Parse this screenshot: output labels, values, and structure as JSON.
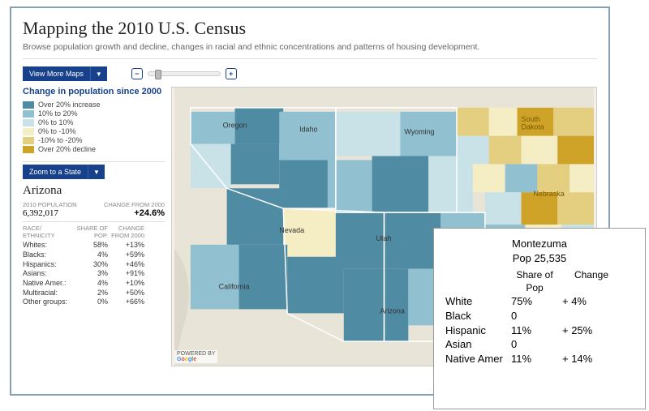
{
  "header": {
    "title": "Mapping the 2010 U.S. Census",
    "subtitle": "Browse population growth and decline, changes in racial and ethnic concentrations and patterns of housing development."
  },
  "buttons": {
    "view_more": "View More Maps",
    "zoom_state": "Zoom to a State"
  },
  "legend": {
    "title": "Change in population since 2000",
    "items": [
      {
        "label": "Over 20% increase",
        "color": "#4f8ca3"
      },
      {
        "label": "10% to 20%",
        "color": "#91c1d0"
      },
      {
        "label": "0% to 10%",
        "color": "#c9e2e7"
      },
      {
        "label": "0% to -10%",
        "color": "#f5edc3"
      },
      {
        "label": "-10% to -20%",
        "color": "#e3cf7f"
      },
      {
        "label": "Over 20% decline",
        "color": "#cfa328"
      }
    ]
  },
  "state_panel": {
    "name": "Arizona",
    "pop_label": "2010 POPULATION",
    "chg_label": "CHANGE FROM 2000",
    "population": "6,392,017",
    "change": "+24.6%",
    "col1": "RACE/ ETHNICITY",
    "col2": "SHARE OF POP.",
    "col3": "CHANGE FROM 2000",
    "rows": [
      {
        "label": "Whites:",
        "share": "58%",
        "change": "+13%"
      },
      {
        "label": "Blacks:",
        "share": "4%",
        "change": "+59%"
      },
      {
        "label": "Hispanics:",
        "share": "30%",
        "change": "+46%"
      },
      {
        "label": "Asians:",
        "share": "3%",
        "change": "+91%"
      },
      {
        "label": "Native Amer.:",
        "share": "4%",
        "change": "+10%"
      },
      {
        "label": "Multiracial:",
        "share": "2%",
        "change": "+50%"
      },
      {
        "label": "Other groups:",
        "share": "0%",
        "change": "+66%"
      }
    ]
  },
  "map": {
    "attribution_prefix": "POWERED BY",
    "attribution": "Google",
    "visible_states": [
      "Oregon",
      "Idaho",
      "Wyoming",
      "Nevada",
      "Utah",
      "California",
      "Arizona",
      "South Dakota",
      "Nebraska"
    ]
  },
  "tooltip": {
    "county": "Montezuma",
    "pop_label": "Pop",
    "pop": "25,535",
    "col_share": "Share of Pop",
    "col_change": "Change",
    "rows": [
      {
        "label": "White",
        "share": "75%",
        "change": "+  4%"
      },
      {
        "label": "Black",
        "share": "0",
        "change": ""
      },
      {
        "label": "Hispanic",
        "share": "11%",
        "change": "+ 25%"
      },
      {
        "label": "Asian",
        "share": "0",
        "change": ""
      },
      {
        "label": "Native Amer",
        "share": "11%",
        "change": "+ 14%"
      }
    ]
  }
}
